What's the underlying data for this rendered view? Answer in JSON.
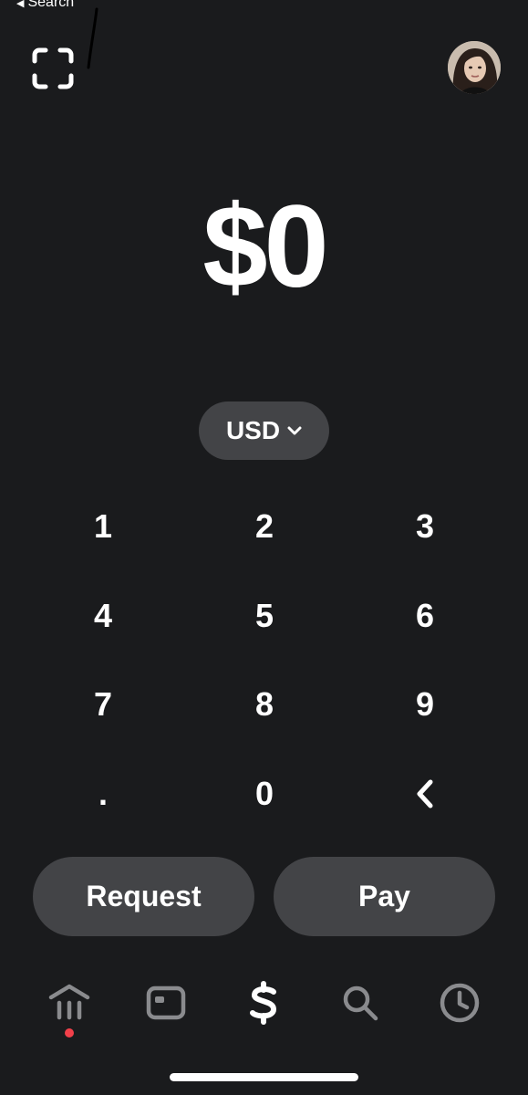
{
  "status_bar": {
    "back_label": "Search"
  },
  "header": {
    "scan_icon": "qr-scan-icon",
    "avatar_icon": "profile-avatar"
  },
  "amount": {
    "display": "$0"
  },
  "currency": {
    "label": "USD",
    "icon": "chevron-down-icon"
  },
  "keypad": {
    "keys": [
      "1",
      "2",
      "3",
      "4",
      "5",
      "6",
      "7",
      "8",
      "9",
      ".",
      "0",
      "‹"
    ]
  },
  "actions": {
    "request_label": "Request",
    "pay_label": "Pay"
  },
  "nav": {
    "items": [
      {
        "icon": "bank-icon",
        "badge": true
      },
      {
        "icon": "card-icon",
        "badge": false
      },
      {
        "icon": "dollar-icon",
        "badge": false,
        "active": true
      },
      {
        "icon": "search-icon",
        "badge": false
      },
      {
        "icon": "clock-icon",
        "badge": false
      }
    ],
    "badge_color": "#f2404a"
  },
  "colors": {
    "background": "#1a1b1d",
    "pill": "#434447",
    "nav_inactive": "#8a8b8e",
    "text": "#ffffff"
  }
}
